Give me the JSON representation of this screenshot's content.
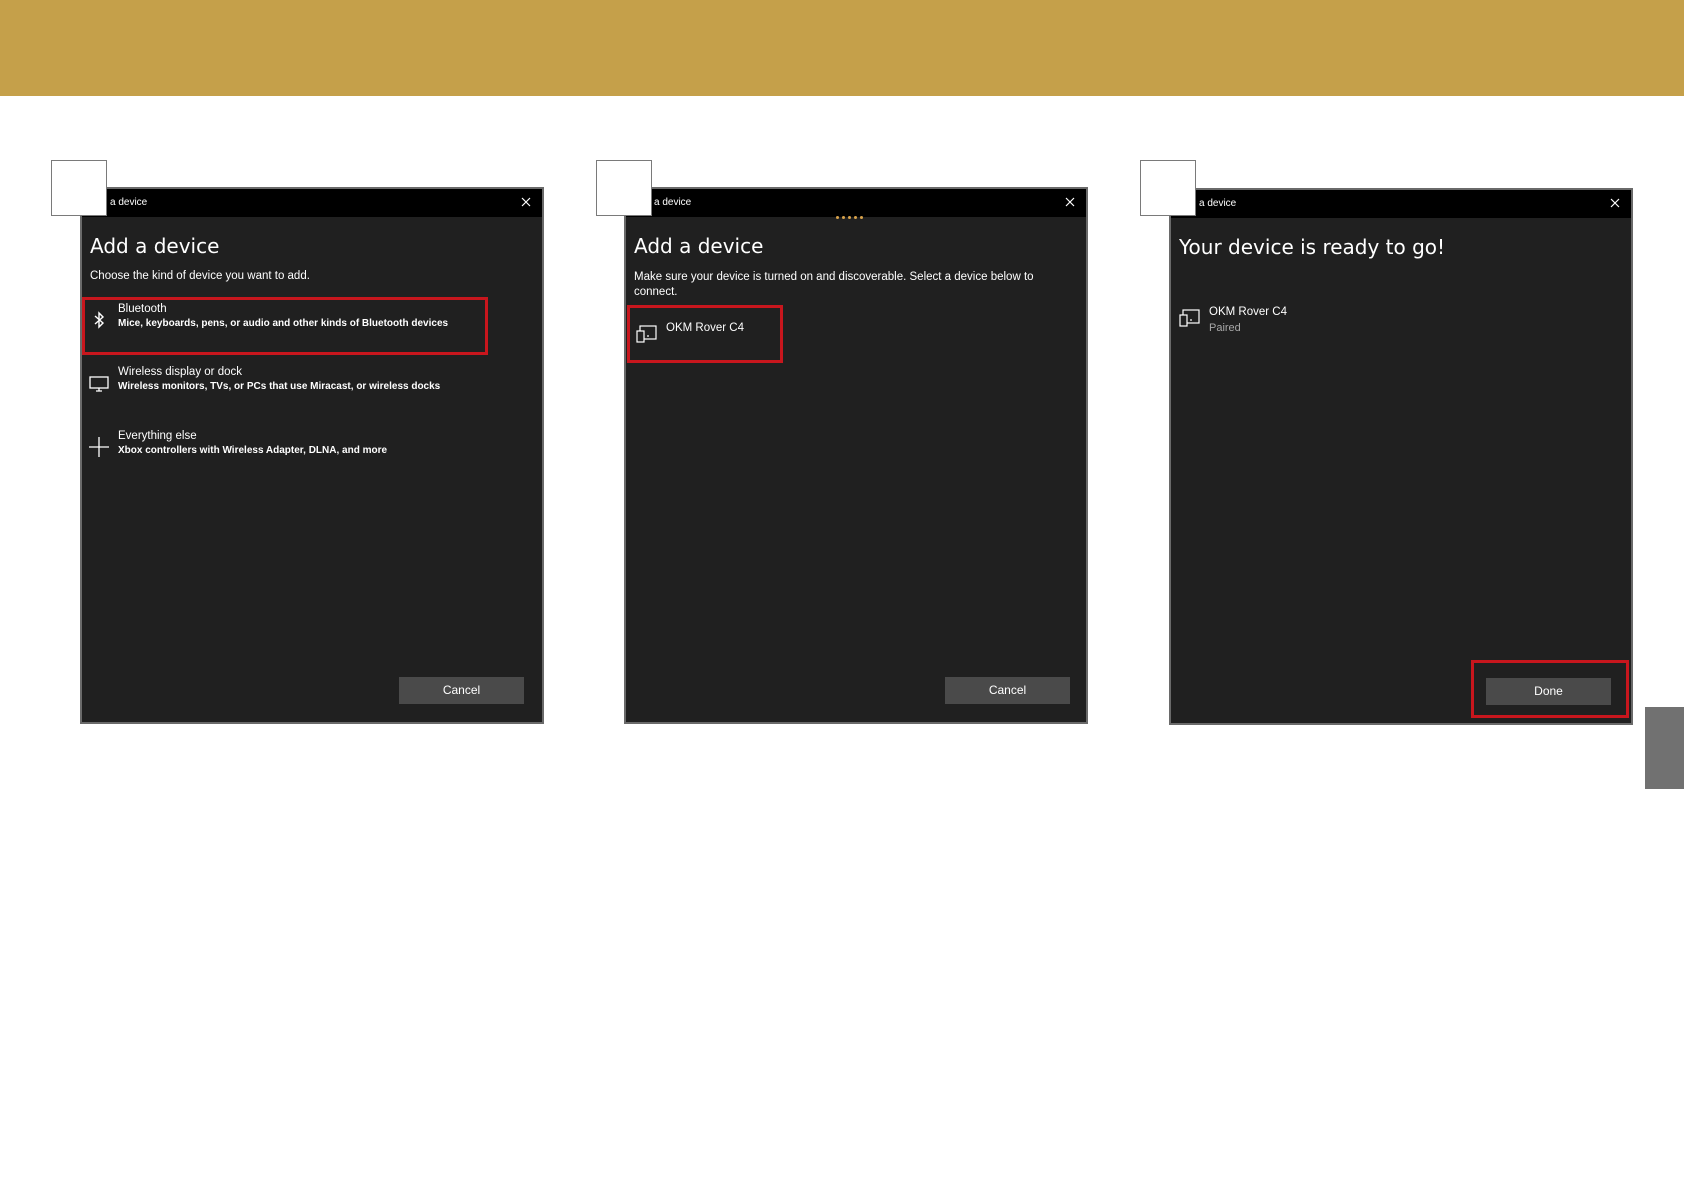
{
  "colors": {
    "top_band": "#C5A04A",
    "side_tab": "#717171",
    "dialog_bg": "#202020",
    "highlight": "#C8161D",
    "button_bg": "#4a4a4a",
    "progress_dots": "#d7a24a"
  },
  "panel1": {
    "title": "a device",
    "heading": "Add a device",
    "subtitle": "Choose the kind of device you want to add.",
    "options": [
      {
        "icon": "bluetooth-icon",
        "title": "Bluetooth",
        "description": "Mice, keyboards, pens, or audio and other kinds of Bluetooth devices"
      },
      {
        "icon": "monitor-icon",
        "title": "Wireless display or dock",
        "description": "Wireless monitors, TVs, or PCs that use Miracast, or wireless docks"
      },
      {
        "icon": "plus-icon",
        "title": "Everything else",
        "description": "Xbox controllers with Wireless Adapter, DLNA, and more"
      }
    ],
    "cancel_label": "Cancel"
  },
  "panel2": {
    "title": "a device",
    "heading": "Add a device",
    "subtitle": "Make sure your device is turned on and discoverable. Select a device below to connect.",
    "device": {
      "icon": "device-icon",
      "name": "OKM Rover C4"
    },
    "cancel_label": "Cancel"
  },
  "panel3": {
    "title": "a device",
    "heading": "Your device is ready to go!",
    "device": {
      "icon": "device-icon",
      "name": "OKM Rover C4",
      "status": "Paired"
    },
    "done_label": "Done"
  }
}
